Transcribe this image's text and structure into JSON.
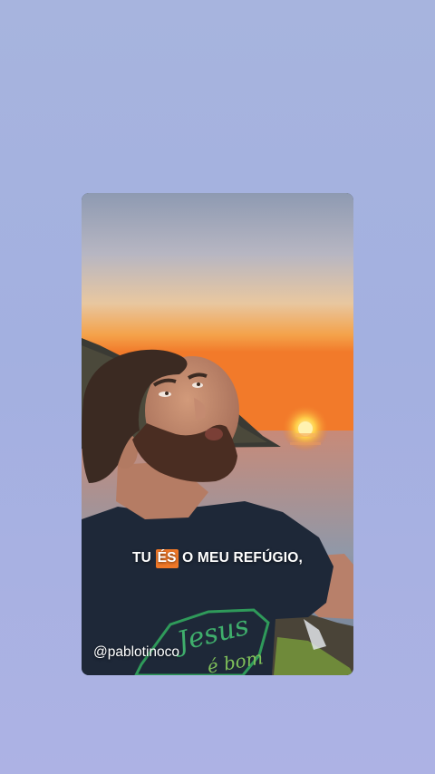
{
  "colors": {
    "background": "#a5b2df",
    "caption_highlight": "#f07828",
    "caption_text": "#ffffff"
  },
  "story": {
    "caption": {
      "before": "TU ",
      "highlight": "ÉS",
      "after": " O MEU REFÚGIO,"
    },
    "handle": "@pablotinoco",
    "shirt_text": "Jesus é bom"
  }
}
